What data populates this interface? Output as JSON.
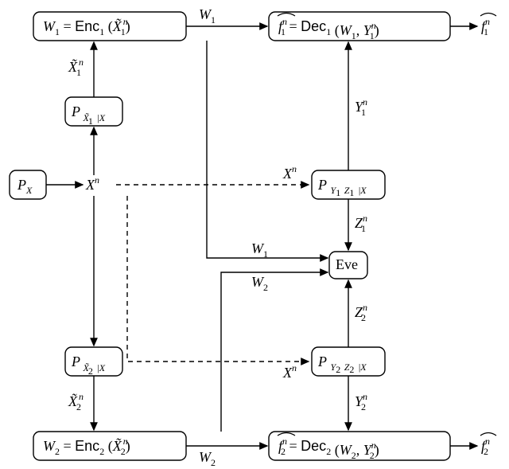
{
  "chart_data": {
    "type": "diagram",
    "title": "Two-user biometric/secrecy system with eavesdropper",
    "nodes": [
      {
        "id": "PX",
        "text": "P_X"
      },
      {
        "id": "Xn",
        "text": "X^n",
        "kind": "junction"
      },
      {
        "id": "PX1",
        "text": "P_{\\tilde X_1 | X}"
      },
      {
        "id": "PX2",
        "text": "P_{\\tilde X_2 | X}"
      },
      {
        "id": "Enc1",
        "text": "W_1 = Enc_1(\\tilde X_1^n)"
      },
      {
        "id": "Enc2",
        "text": "W_2 = Enc_2(\\tilde X_2^n)"
      },
      {
        "id": "PY1",
        "text": "P_{Y_1 Z_1 | X}"
      },
      {
        "id": "PY2",
        "text": "P_{Y_2 Z_2 | X}"
      },
      {
        "id": "Eve",
        "text": "Eve"
      },
      {
        "id": "Dec1",
        "text": "\\hat f_1^n = Dec_1(W_1, Y_1^n)"
      },
      {
        "id": "Dec2",
        "text": "\\hat f_2^n = Dec_2(W_2, Y_2^n)"
      }
    ],
    "edges": [
      {
        "from": "PX",
        "to": "Xn",
        "label": ""
      },
      {
        "from": "Xn",
        "to": "PX1",
        "label": ""
      },
      {
        "from": "Xn",
        "to": "PX2",
        "label": ""
      },
      {
        "from": "PX1",
        "to": "Enc1",
        "label": "\\tilde X_1^n"
      },
      {
        "from": "PX2",
        "to": "Enc2",
        "label": "\\tilde X_2^n"
      },
      {
        "from": "Enc1",
        "to": "Dec1",
        "label": "W_1"
      },
      {
        "from": "Enc2",
        "to": "Dec2",
        "label": "W_2"
      },
      {
        "from": "Xn",
        "to": "PY1",
        "label": "X^n",
        "style": "dashed"
      },
      {
        "from": "Xn",
        "to": "PY2",
        "label": "X^n",
        "style": "dashed"
      },
      {
        "from": "PY1",
        "to": "Dec1",
        "label": "Y_1^n"
      },
      {
        "from": "PY2",
        "to": "Dec2",
        "label": "Y_2^n"
      },
      {
        "from": "PY1",
        "to": "Eve",
        "label": "Z_1^n"
      },
      {
        "from": "PY2",
        "to": "Eve",
        "label": "Z_2^n"
      },
      {
        "from": "Enc1",
        "to": "Eve",
        "label": "W_1"
      },
      {
        "from": "Enc2",
        "to": "Eve",
        "label": "W_2"
      },
      {
        "from": "Dec1",
        "to": "out1",
        "label": "\\hat f_1^n"
      },
      {
        "from": "Dec2",
        "to": "out2",
        "label": "\\hat f_2^n"
      }
    ]
  },
  "L": {
    "PX": "P",
    "X": "X",
    "Xt": "X̃",
    "W": "W",
    "Enc": "Enc",
    "Dec": "Dec",
    "f": "f",
    "fhat": "f̂",
    "Y": "Y",
    "Z": "Z",
    "Eve": "Eve",
    "n": "n",
    "bar": "|",
    "1": "1",
    "2": "2",
    "lp": "(",
    "rp": ")",
    "eq": " = ",
    ",": ", "
  }
}
